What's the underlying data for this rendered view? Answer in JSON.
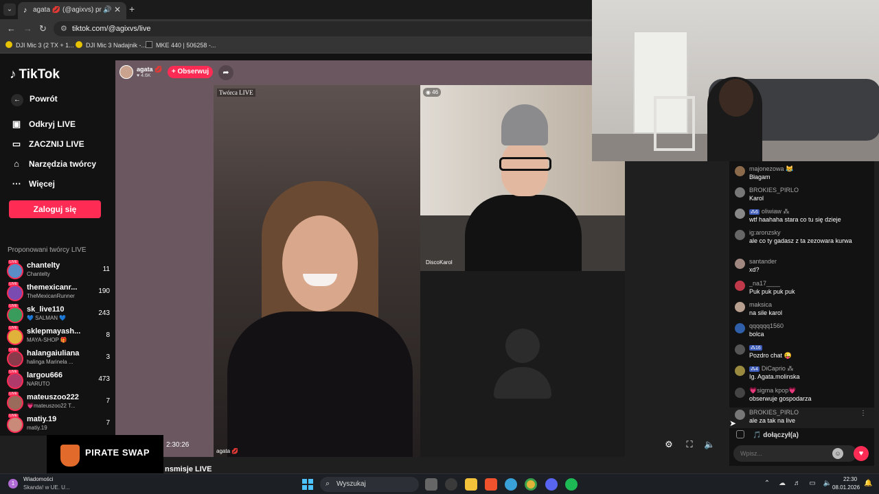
{
  "browser": {
    "tab_title": "agata 💋 (@agixvs) prowadzi",
    "url": "tiktok.com/@agixvs/live",
    "bookmarks": [
      "DJI Mic 3 (2 TX + 1...",
      "DJI Mic 3 Nadajnik -...",
      "MKE 440 | 506258 -..."
    ]
  },
  "sidebar": {
    "logo": "TikTok",
    "back": "Powrót",
    "links": [
      "Odkryj LIVE",
      "ZACZNIJ LIVE",
      "Narzędzia twórcy",
      "Więcej"
    ],
    "login": "Zaloguj się",
    "suggest_title": "Proponowani twórcy LIVE",
    "creators": [
      {
        "name": "chantelty",
        "sub": "Chantelty",
        "count": "11"
      },
      {
        "name": "themexicanr...",
        "sub": "TheMexicanRunner",
        "count": "190"
      },
      {
        "name": "sk_live110",
        "sub": "💙 SALMAN 💙",
        "count": "243"
      },
      {
        "name": "sklepmayash...",
        "sub": "MAYA-SHOP 🎁",
        "count": "8"
      },
      {
        "name": "halangaiuliana",
        "sub": "halinga Marinela ...",
        "count": "3"
      },
      {
        "name": "largou666",
        "sub": "NARUTO",
        "count": "473"
      },
      {
        "name": "mateuszoo222",
        "sub": "💗mateuszoo22 T...",
        "count": "7"
      },
      {
        "name": "matiy.19",
        "sub": "matiy.19",
        "count": "7"
      }
    ],
    "live_badge": "LIVE"
  },
  "stream": {
    "host_name": "agata 💋",
    "host_likes": "♥ 4.6K",
    "follow": "+ Obserwuj",
    "creator_label": "Twórca LIVE",
    "main_cam_name": "agata 💋",
    "viewer_count": "◉ 46",
    "guest_name": "DiscoKarol",
    "timer": "2:30:26",
    "below_title": "nsmisje LIVE",
    "pirate_text": "PIRATE SWAP"
  },
  "chat": {
    "messages": [
      {
        "user": "majonezowa 😹",
        "badge": "",
        "text": "Błagam"
      },
      {
        "user": "BROKIES_PIRLO",
        "badge": "",
        "text": "Karol"
      },
      {
        "user": "oliwiaw ⁂",
        "badge": "⁂6",
        "text": "wtf haahaha stara co tu się dzieje"
      },
      {
        "user": "ig:aronzsky",
        "badge": "",
        "text": "ale co ty gadasz z ta zezowara kurwa"
      },
      {
        "user": "santander",
        "badge": "",
        "text": "xd?"
      },
      {
        "user": "_na17____",
        "badge": "",
        "text": "Puk puk puk puk"
      },
      {
        "user": "maksica",
        "badge": "",
        "text": "na sile karol"
      },
      {
        "user": "qqqqqq1560",
        "badge": "",
        "text": "bolca"
      },
      {
        "user": "",
        "badge": "⁂16",
        "text": "Pozdro chat 😜"
      },
      {
        "user": "DiCaprio ⁂",
        "badge": "⁂4",
        "text": "Ig. Agata.molinska"
      },
      {
        "user": "💗sigma kpop💗",
        "badge": "",
        "text": "obserwuje gospodarza"
      },
      {
        "user": "BROKIES_PIRLO",
        "badge": "",
        "text": "ale za tak na live"
      }
    ],
    "join_text": "🎵 dołączył(a)",
    "input_placeholder": "Wpisz..."
  },
  "taskbar": {
    "notif_count": "1",
    "notif_title": "Wiadomości",
    "notif_text": "Skanda! w UE. U...",
    "search": "Wyszukaj",
    "time": "22:30",
    "date": "08.01.2026"
  },
  "colors": {
    "accent": "#fe2c55",
    "stream_bg": "#6a5760"
  }
}
